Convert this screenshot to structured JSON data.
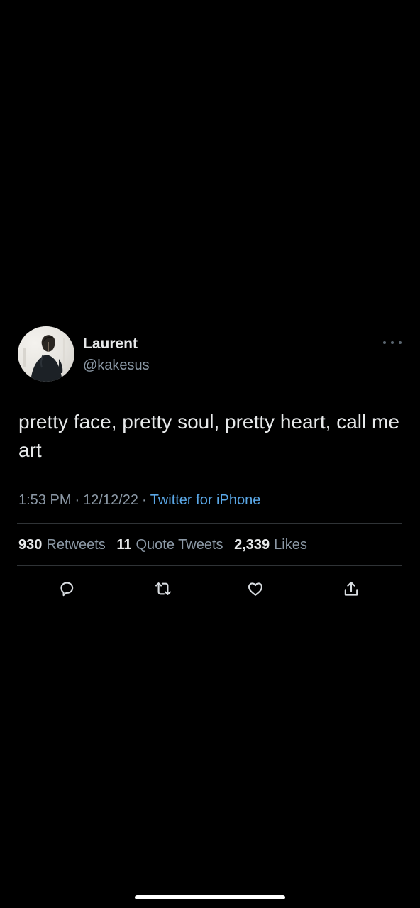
{
  "tweet": {
    "author": {
      "display_name": "Laurent",
      "handle": "@kakesus",
      "avatar_icon": "profile-photo"
    },
    "text": "pretty face, pretty soul, pretty heart, call me art",
    "time": "1:53 PM",
    "date": "12/12/22",
    "separator": "·",
    "source": "Twitter for iPhone",
    "stats": {
      "retweets_count": "930",
      "retweets_label": "Retweets",
      "quotes_count": "11",
      "quotes_label": "Quote Tweets",
      "likes_count": "2,339",
      "likes_label": "Likes"
    },
    "actions": [
      "reply-icon",
      "retweet-icon",
      "like-icon",
      "share-icon"
    ]
  },
  "colors": {
    "background": "#000000",
    "text_primary": "#e7e9ea",
    "text_secondary": "#8b98a5",
    "link": "#5aa7e6",
    "divider": "#2f3336"
  }
}
